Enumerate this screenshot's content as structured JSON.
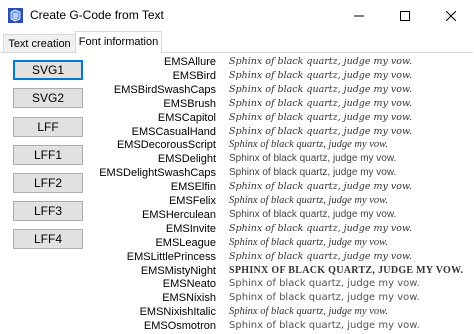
{
  "window": {
    "title": "Create G-Code from Text",
    "controls": [
      "minimize",
      "maximize",
      "close"
    ]
  },
  "tabs": [
    {
      "label": "Text creation",
      "active": false
    },
    {
      "label": "Font information",
      "active": true
    }
  ],
  "buttons": [
    {
      "label": "SVG1",
      "focused": true
    },
    {
      "label": "SVG2",
      "focused": false
    },
    {
      "label": "LFF",
      "focused": false
    },
    {
      "label": "LFF1",
      "focused": false
    },
    {
      "label": "LFF2",
      "focused": false
    },
    {
      "label": "LFF3",
      "focused": false
    },
    {
      "label": "LFF4",
      "focused": false
    }
  ],
  "fonts": [
    {
      "name": "EMSAllure",
      "sample": "Sphinx of black quartz, judge my vow.",
      "style": "script"
    },
    {
      "name": "EMSBird",
      "sample": "Sphinx of black quartz, judge my vow.",
      "style": "script"
    },
    {
      "name": "EMSBirdSwashCaps",
      "sample": "Sphinx of black quartz, judge my vow.",
      "style": "script"
    },
    {
      "name": "EMSBrush",
      "sample": "Sphinx of black quartz, judge my vow.",
      "style": "script"
    },
    {
      "name": "EMSCapitol",
      "sample": "Sphinx of black quartz, judge my vow.",
      "style": "script"
    },
    {
      "name": "EMSCasualHand",
      "sample": "Sphinx of black quartz, judge my vow.",
      "style": "script"
    },
    {
      "name": "EMSDecorousScript",
      "sample": "Sphinx of black quartz, judge my vow.",
      "style": "serif-it"
    },
    {
      "name": "EMSDelight",
      "sample": "Sphinx of black quartz, judge my vow.",
      "style": "sans"
    },
    {
      "name": "EMSDelightSwashCaps",
      "sample": "Sphinx of black quartz, judge my vow.",
      "style": "sans"
    },
    {
      "name": "EMSElfin",
      "sample": "Sphinx of black quartz, judge my vow.",
      "style": "script"
    },
    {
      "name": "EMSFelix",
      "sample": "Sphinx of black quartz, judge my vow.",
      "style": "serif-it"
    },
    {
      "name": "EMSHerculean",
      "sample": "Sphinx of black quartz, judge my vow.",
      "style": "sans"
    },
    {
      "name": "EMSInvite",
      "sample": "Sphinx of black quartz, judge my vow.",
      "style": "script"
    },
    {
      "name": "EMSLeague",
      "sample": "Sphinx of black quartz, judge my vow.",
      "style": "serif-it"
    },
    {
      "name": "EMSLittlePrincess",
      "sample": "Sphinx of black quartz, judge my vow.",
      "style": "script"
    },
    {
      "name": "EMSMistyNight",
      "sample": "SPHINX OF BLACK QUARTZ, JUDGE MY VOW.",
      "style": "bold"
    },
    {
      "name": "EMSNeato",
      "sample": "Sphinx of black quartz, judge my vow.",
      "style": "light"
    },
    {
      "name": "EMSNixish",
      "sample": "Sphinx of black quartz, judge my vow.",
      "style": "light"
    },
    {
      "name": "EMSNixishItalic",
      "sample": "Sphinx of black quartz, judge my vow.",
      "style": "serif-it"
    },
    {
      "name": "EMSOsmotron",
      "sample": "Sphinx of black quartz, judge my vow.",
      "style": "light"
    }
  ],
  "colors": {
    "focus_border": "#0078d7",
    "button_face": "#e1e1e1",
    "tab_border": "#d9d9d9"
  },
  "icons": {
    "app": "app-icon",
    "minimize": "minimize-icon",
    "maximize": "maximize-icon",
    "close": "close-icon"
  }
}
